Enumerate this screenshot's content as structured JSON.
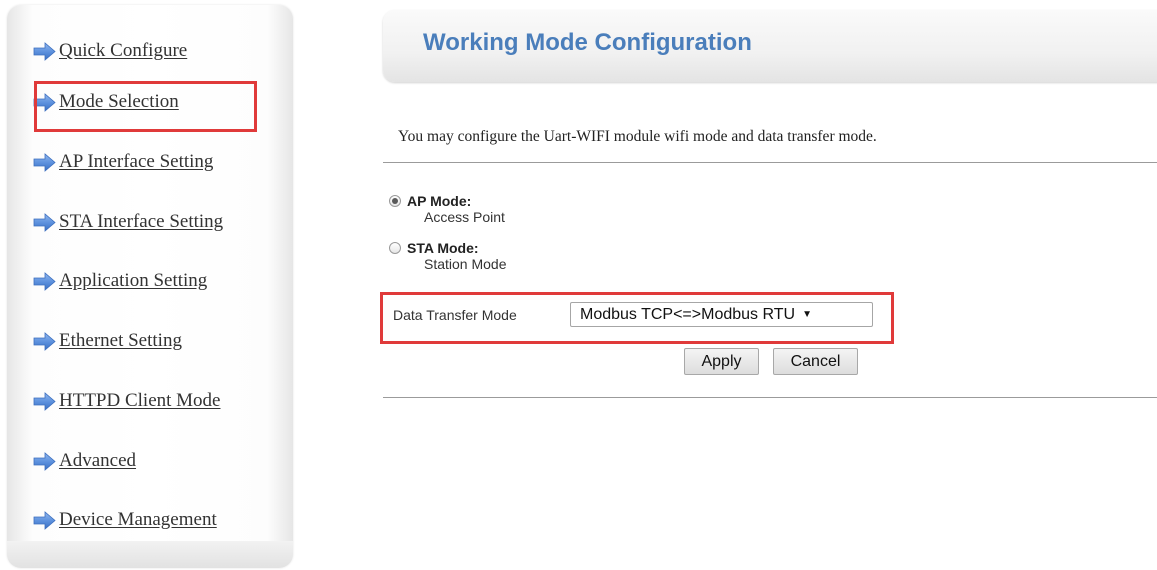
{
  "sidebar": {
    "items": [
      {
        "label": "Quick Configure",
        "name": "sidebar-item-quick-configure"
      },
      {
        "label": "Mode Selection",
        "name": "sidebar-item-mode-selection"
      },
      {
        "label": "AP Interface Setting",
        "name": "sidebar-item-ap-interface-setting"
      },
      {
        "label": "STA Interface Setting",
        "name": "sidebar-item-sta-interface-setting"
      },
      {
        "label": "Application Setting",
        "name": "sidebar-item-application-setting"
      },
      {
        "label": "Ethernet Setting",
        "name": "sidebar-item-ethernet-setting"
      },
      {
        "label": "HTTPD Client Mode",
        "name": "sidebar-item-httpd-client-mode"
      },
      {
        "label": "Advanced",
        "name": "sidebar-item-advanced"
      },
      {
        "label": "Device Management",
        "name": "sidebar-item-device-management"
      }
    ],
    "icon": "arrow-right-icon",
    "highlighted_item": "Mode Selection"
  },
  "main": {
    "title": "Working Mode Configuration",
    "description": "You may configure the Uart-WIFI module wifi mode and data transfer mode.",
    "modes": [
      {
        "label": "AP Mode:",
        "sub": "Access Point",
        "checked": true
      },
      {
        "label": "STA Mode:",
        "sub": "Station Mode",
        "checked": false
      }
    ],
    "data_transfer": {
      "label": "Data Transfer Mode",
      "selected": "Modbus TCP<=>Modbus RTU"
    },
    "buttons": {
      "apply": "Apply",
      "cancel": "Cancel"
    }
  },
  "colors": {
    "title": "#4a7ebb",
    "highlight": "#e03a3a",
    "arrow": "#5a8fdc",
    "link": "#333333"
  }
}
